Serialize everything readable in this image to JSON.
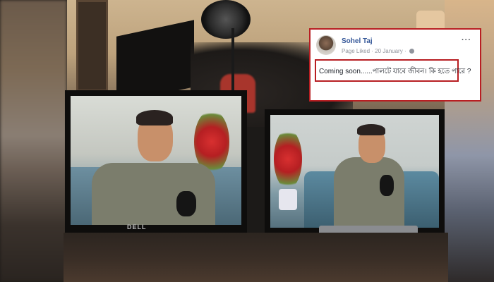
{
  "post": {
    "author": "Sohel Taj",
    "meta": "Page Liked · 20 January ·",
    "privacy_icon": "globe-icon",
    "more_icon": "ellipsis-icon",
    "text": "Coming soon......পালটে যাবে জীবন। কি হতে পারে ?"
  },
  "monitor": {
    "brand": "DELL"
  },
  "colors": {
    "highlight_border": "#b81e22",
    "fb_name": "#365899"
  }
}
